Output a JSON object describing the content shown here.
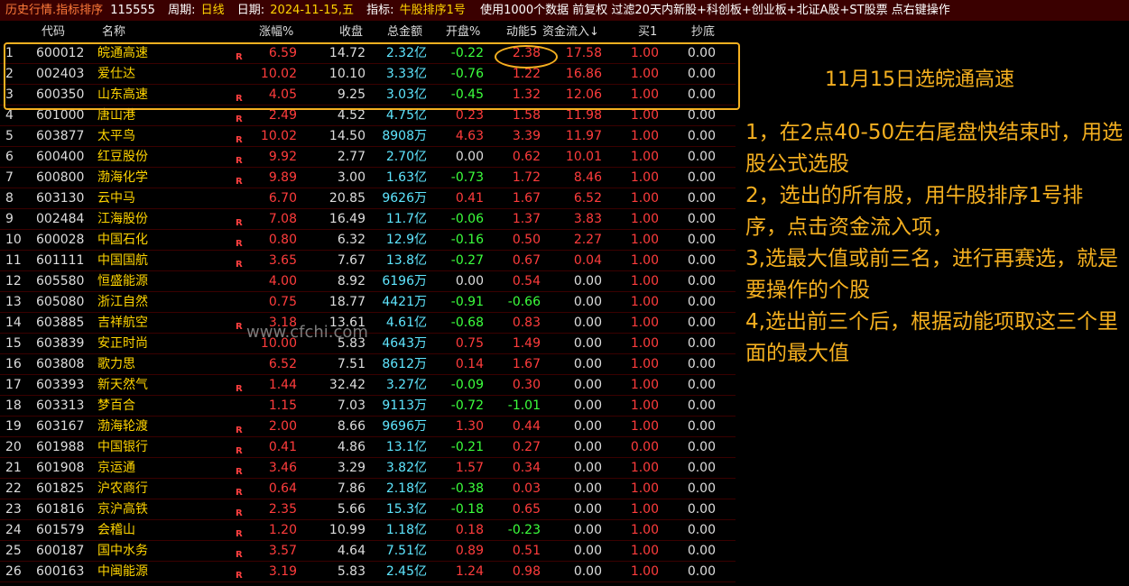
{
  "titlebar": {
    "app": "历史行情.指标排序",
    "code": "115555",
    "period_label": "周期:",
    "period": "日线",
    "date_label": "日期:",
    "date": "2024-11-15,五",
    "indicator_label": "指标:",
    "indicator": "牛股排序1号",
    "desc": "使用1000个数据 前复权 过滤20天内新股+科创板+创业板+北证A股+ST股票 点右键操作"
  },
  "columns": [
    "代码",
    "名称",
    "涨幅%",
    "收盘",
    "总金额",
    "开盘%",
    "动能5",
    "资金流入↓",
    "买1",
    "抄底"
  ],
  "colors": {
    "red": "#ff3c3c",
    "green": "#3cff3c",
    "cyan": "#5fe6ff",
    "yellow": "#ffd400",
    "orange": "#f5b020"
  },
  "rows": [
    {
      "idx": "1",
      "code": "600012",
      "name": "皖通高速",
      "r": "R",
      "chg": "6.59",
      "close": "14.72",
      "amt": "2.32亿",
      "open": "-0.22",
      "open_c": "green",
      "dyn": "2.38",
      "dyn_c": "red",
      "flow": "17.58",
      "flow_c": "red",
      "buy": "1.00",
      "bottom": "0.00"
    },
    {
      "idx": "2",
      "code": "002403",
      "name": "爱仕达",
      "r": "",
      "chg": "10.02",
      "close": "10.10",
      "amt": "3.33亿",
      "open": "-0.76",
      "open_c": "green",
      "dyn": "1.22",
      "dyn_c": "red",
      "flow": "16.86",
      "flow_c": "red",
      "buy": "1.00",
      "bottom": "0.00"
    },
    {
      "idx": "3",
      "code": "600350",
      "name": "山东高速",
      "r": "R",
      "chg": "4.05",
      "close": "9.25",
      "amt": "3.03亿",
      "open": "-0.45",
      "open_c": "green",
      "dyn": "1.32",
      "dyn_c": "red",
      "flow": "12.06",
      "flow_c": "red",
      "buy": "1.00",
      "bottom": "0.00"
    },
    {
      "idx": "4",
      "code": "601000",
      "name": "唐山港",
      "r": "R",
      "chg": "2.49",
      "close": "4.52",
      "amt": "4.75亿",
      "open": "0.23",
      "open_c": "red",
      "dyn": "1.58",
      "dyn_c": "red",
      "flow": "11.98",
      "flow_c": "red",
      "buy": "1.00",
      "bottom": "0.00"
    },
    {
      "idx": "5",
      "code": "603877",
      "name": "太平鸟",
      "r": "R",
      "chg": "10.02",
      "close": "14.50",
      "amt": "8908万",
      "open": "4.63",
      "open_c": "red",
      "dyn": "3.39",
      "dyn_c": "red",
      "flow": "11.97",
      "flow_c": "red",
      "buy": "1.00",
      "bottom": "0.00"
    },
    {
      "idx": "6",
      "code": "600400",
      "name": "红豆股份",
      "r": "R",
      "chg": "9.92",
      "close": "2.77",
      "amt": "2.70亿",
      "open": "0.00",
      "open_c": "white",
      "dyn": "0.62",
      "dyn_c": "red",
      "flow": "10.01",
      "flow_c": "red",
      "buy": "1.00",
      "bottom": "0.00"
    },
    {
      "idx": "7",
      "code": "600800",
      "name": "渤海化学",
      "r": "R",
      "chg": "9.89",
      "close": "3.00",
      "amt": "1.63亿",
      "open": "-0.73",
      "open_c": "green",
      "dyn": "1.72",
      "dyn_c": "red",
      "flow": "8.46",
      "flow_c": "red",
      "buy": "1.00",
      "bottom": "0.00"
    },
    {
      "idx": "8",
      "code": "603130",
      "name": "云中马",
      "r": "",
      "chg": "6.70",
      "close": "20.85",
      "amt": "9626万",
      "open": "0.41",
      "open_c": "red",
      "dyn": "1.67",
      "dyn_c": "red",
      "flow": "6.52",
      "flow_c": "red",
      "buy": "1.00",
      "bottom": "0.00"
    },
    {
      "idx": "9",
      "code": "002484",
      "name": "江海股份",
      "r": "R",
      "chg": "7.08",
      "close": "16.49",
      "amt": "11.7亿",
      "open": "-0.06",
      "open_c": "green",
      "dyn": "1.37",
      "dyn_c": "red",
      "flow": "3.83",
      "flow_c": "red",
      "buy": "1.00",
      "bottom": "0.00"
    },
    {
      "idx": "10",
      "code": "600028",
      "name": "中国石化",
      "r": "R",
      "chg": "0.80",
      "close": "6.32",
      "amt": "12.9亿",
      "open": "-0.16",
      "open_c": "green",
      "dyn": "0.50",
      "dyn_c": "red",
      "flow": "2.27",
      "flow_c": "red",
      "buy": "1.00",
      "bottom": "0.00"
    },
    {
      "idx": "11",
      "code": "601111",
      "name": "中国国航",
      "r": "R",
      "chg": "3.65",
      "close": "7.67",
      "amt": "13.8亿",
      "open": "-0.27",
      "open_c": "green",
      "dyn": "0.67",
      "dyn_c": "red",
      "flow": "0.04",
      "flow_c": "red",
      "buy": "1.00",
      "bottom": "0.00"
    },
    {
      "idx": "12",
      "code": "605580",
      "name": "恒盛能源",
      "r": "",
      "chg": "4.00",
      "close": "8.92",
      "amt": "6196万",
      "open": "0.00",
      "open_c": "white",
      "dyn": "0.54",
      "dyn_c": "red",
      "flow": "0.00",
      "flow_c": "white",
      "buy": "1.00",
      "bottom": "0.00"
    },
    {
      "idx": "13",
      "code": "605080",
      "name": "浙江自然",
      "r": "",
      "chg": "0.75",
      "close": "18.77",
      "amt": "4421万",
      "open": "-0.91",
      "open_c": "green",
      "dyn": "-0.66",
      "dyn_c": "green",
      "flow": "0.00",
      "flow_c": "white",
      "buy": "1.00",
      "bottom": "0.00"
    },
    {
      "idx": "14",
      "code": "603885",
      "name": "吉祥航空",
      "r": "R",
      "chg": "3.18",
      "close": "13.61",
      "amt": "4.61亿",
      "open": "-0.68",
      "open_c": "green",
      "dyn": "0.83",
      "dyn_c": "red",
      "flow": "0.00",
      "flow_c": "white",
      "buy": "1.00",
      "bottom": "0.00"
    },
    {
      "idx": "15",
      "code": "603839",
      "name": "安正时尚",
      "r": "",
      "chg": "10.00",
      "close": "5.83",
      "amt": "4643万",
      "open": "0.75",
      "open_c": "red",
      "dyn": "1.49",
      "dyn_c": "red",
      "flow": "0.00",
      "flow_c": "white",
      "buy": "1.00",
      "bottom": "0.00"
    },
    {
      "idx": "16",
      "code": "603808",
      "name": "歌力思",
      "r": "",
      "chg": "6.52",
      "close": "7.51",
      "amt": "8612万",
      "open": "0.14",
      "open_c": "red",
      "dyn": "1.67",
      "dyn_c": "red",
      "flow": "0.00",
      "flow_c": "white",
      "buy": "1.00",
      "bottom": "0.00"
    },
    {
      "idx": "17",
      "code": "603393",
      "name": "新天然气",
      "r": "R",
      "chg": "1.44",
      "close": "32.42",
      "amt": "3.27亿",
      "open": "-0.09",
      "open_c": "green",
      "dyn": "0.30",
      "dyn_c": "red",
      "flow": "0.00",
      "flow_c": "white",
      "buy": "1.00",
      "bottom": "0.00"
    },
    {
      "idx": "18",
      "code": "603313",
      "name": "梦百合",
      "r": "",
      "chg": "1.15",
      "close": "7.03",
      "amt": "9113万",
      "open": "-0.72",
      "open_c": "green",
      "dyn": "-1.01",
      "dyn_c": "green",
      "flow": "0.00",
      "flow_c": "white",
      "buy": "1.00",
      "bottom": "0.00"
    },
    {
      "idx": "19",
      "code": "603167",
      "name": "渤海轮渡",
      "r": "R",
      "chg": "2.00",
      "close": "8.66",
      "amt": "9696万",
      "open": "1.30",
      "open_c": "red",
      "dyn": "0.44",
      "dyn_c": "red",
      "flow": "0.00",
      "flow_c": "white",
      "buy": "1.00",
      "bottom": "0.00"
    },
    {
      "idx": "20",
      "code": "601988",
      "name": "中国银行",
      "r": "R",
      "chg": "0.41",
      "close": "4.86",
      "amt": "13.1亿",
      "open": "-0.21",
      "open_c": "green",
      "dyn": "0.27",
      "dyn_c": "red",
      "flow": "0.00",
      "flow_c": "white",
      "buy": "0.00",
      "bottom": "0.00"
    },
    {
      "idx": "21",
      "code": "601908",
      "name": "京运通",
      "r": "R",
      "chg": "3.46",
      "close": "3.29",
      "amt": "3.82亿",
      "open": "1.57",
      "open_c": "red",
      "dyn": "0.34",
      "dyn_c": "red",
      "flow": "0.00",
      "flow_c": "white",
      "buy": "1.00",
      "bottom": "0.00"
    },
    {
      "idx": "22",
      "code": "601825",
      "name": "沪农商行",
      "r": "R",
      "chg": "0.64",
      "close": "7.86",
      "amt": "2.18亿",
      "open": "-0.38",
      "open_c": "green",
      "dyn": "0.03",
      "dyn_c": "red",
      "flow": "0.00",
      "flow_c": "white",
      "buy": "1.00",
      "bottom": "0.00"
    },
    {
      "idx": "23",
      "code": "601816",
      "name": "京沪高铁",
      "r": "R",
      "chg": "2.35",
      "close": "5.66",
      "amt": "15.3亿",
      "open": "-0.18",
      "open_c": "green",
      "dyn": "0.65",
      "dyn_c": "red",
      "flow": "0.00",
      "flow_c": "white",
      "buy": "1.00",
      "bottom": "0.00"
    },
    {
      "idx": "24",
      "code": "601579",
      "name": "会稽山",
      "r": "R",
      "chg": "1.20",
      "close": "10.99",
      "amt": "1.18亿",
      "open": "0.18",
      "open_c": "red",
      "dyn": "-0.23",
      "dyn_c": "green",
      "flow": "0.00",
      "flow_c": "white",
      "buy": "1.00",
      "bottom": "0.00"
    },
    {
      "idx": "25",
      "code": "600187",
      "name": "国中水务",
      "r": "R",
      "chg": "3.57",
      "close": "4.64",
      "amt": "7.51亿",
      "open": "0.89",
      "open_c": "red",
      "dyn": "0.51",
      "dyn_c": "red",
      "flow": "0.00",
      "flow_c": "white",
      "buy": "1.00",
      "bottom": "0.00"
    },
    {
      "idx": "26",
      "code": "600163",
      "name": "中闽能源",
      "r": "R",
      "chg": "3.19",
      "close": "5.83",
      "amt": "2.45亿",
      "open": "1.24",
      "open_c": "red",
      "dyn": "0.98",
      "dyn_c": "red",
      "flow": "0.00",
      "flow_c": "white",
      "buy": "1.00",
      "bottom": "0.00"
    }
  ],
  "annotation": {
    "title": "11月15日选皖通高速",
    "lines": [
      "1，在2点40-50左右尾盘快结束时，用选股公式选股",
      "2，选出的所有股，用牛股排序1号排序，点击资金流入项，",
      "3,选最大值或前三名，进行再赛选，就是要操作的个股",
      "4,选出前三个后，根据动能项取这三个里面的最大值"
    ]
  },
  "watermark": "www.cfchi.com"
}
